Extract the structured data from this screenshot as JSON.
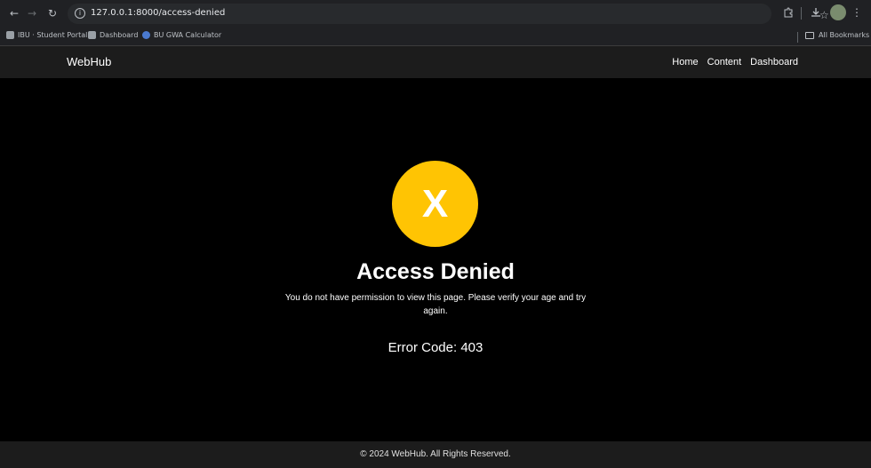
{
  "browser": {
    "url": "127.0.0.1:8000/access-denied",
    "icons": {
      "back": "arrow-left-icon",
      "forward": "arrow-right-icon",
      "reload": "reload-icon",
      "bookmark": "star-icon",
      "extensions": "puzzle-icon",
      "download": "download-icon",
      "menu": "kebab-menu-icon"
    },
    "bookmarks": [
      {
        "label": "IBU · Student Portal"
      },
      {
        "label": "Dashboard"
      },
      {
        "label": "BU GWA Calculator"
      }
    ],
    "all_bookmarks": "All Bookmarks"
  },
  "site": {
    "brand": "WebHub",
    "nav": {
      "home": "Home",
      "content": "Content",
      "dashboard": "Dashboard"
    }
  },
  "error": {
    "icon_text": "X",
    "title": "Access Denied",
    "message": "You do not have permission to view this page. Please verify your age and try again.",
    "code": "Error Code: 403",
    "accent_color": "#ffc403"
  },
  "footer": {
    "text": "© 2024 WebHub. All Rights Reserved."
  }
}
